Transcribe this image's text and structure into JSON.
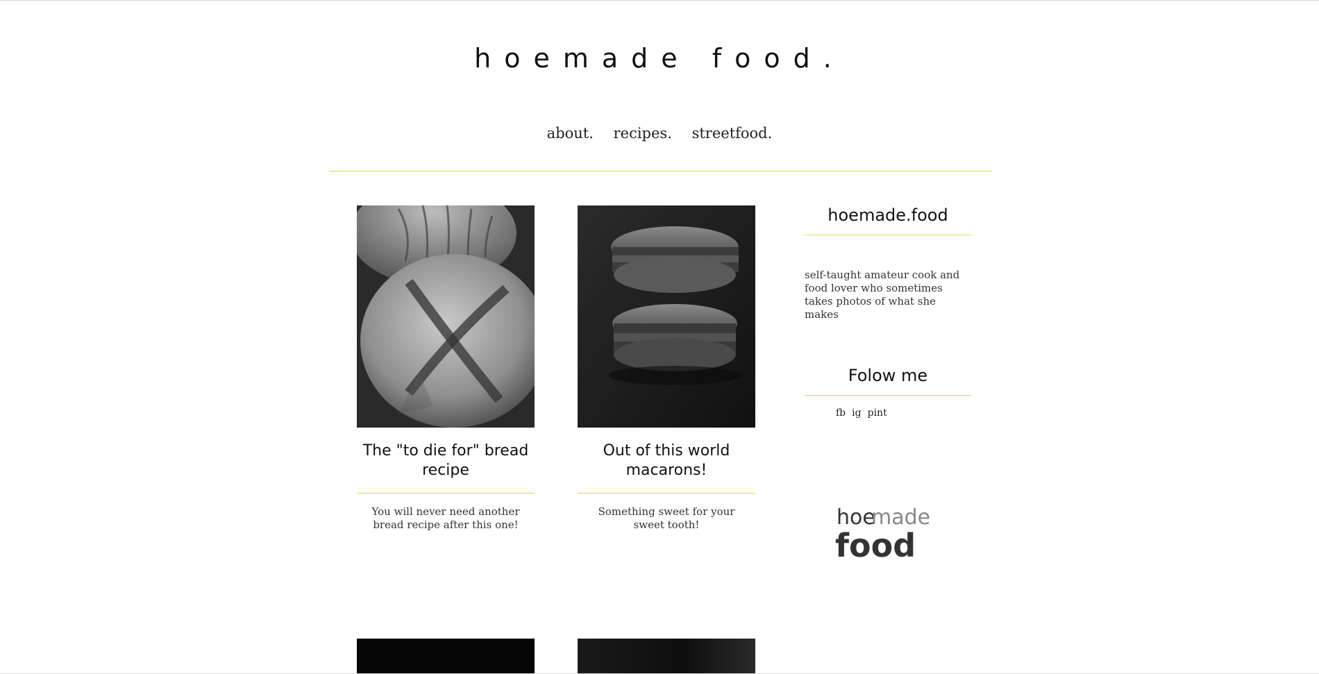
{
  "site": {
    "title": "hoemade food."
  },
  "nav": {
    "items": [
      {
        "label": "about."
      },
      {
        "label": "recipes."
      },
      {
        "label": "streetfood."
      }
    ]
  },
  "posts": [
    {
      "title": "The \"to die for\" bread recipe",
      "excerpt": "You will never need another bread recipe after this one!",
      "image": "bread-photo"
    },
    {
      "title": "Out of this world macarons!",
      "excerpt": "Something sweet for your sweet tooth!",
      "image": "macarons-photo"
    }
  ],
  "sidebar": {
    "profile_title": "hoemade.food",
    "about": "self-taught amateur cook and food lover who sometimes takes photos of what she makes",
    "follow_title": "Folow me",
    "social": [
      {
        "label": "fb"
      },
      {
        "label": "ig"
      },
      {
        "label": "pint"
      }
    ],
    "logo": {
      "line1_a": "hoe",
      "line1_b": "made",
      "line2": "food"
    }
  },
  "colors": {
    "accent_rule": "#e2d44a",
    "text": "#111111",
    "background": "#ffffff"
  }
}
